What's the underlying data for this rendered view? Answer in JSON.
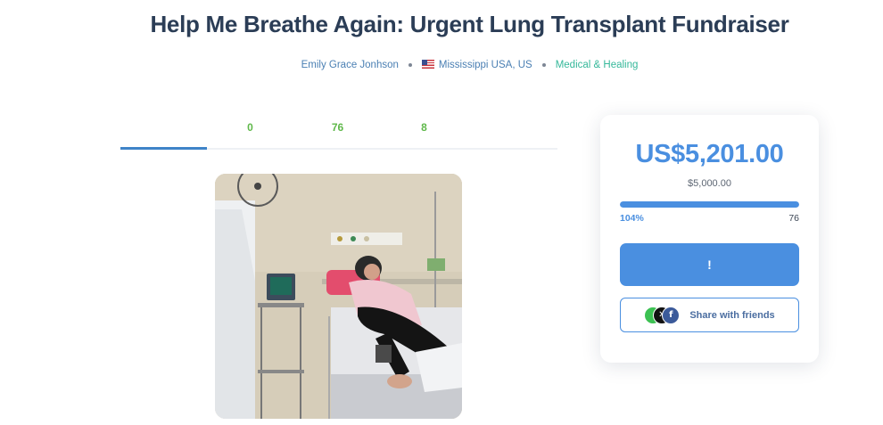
{
  "campaign": {
    "title": "Help Me Breathe Again: Urgent Lung Transplant Fundraiser",
    "organizer": "Emily Grace Jonhson",
    "location": "Mississippi USA, US",
    "category": "Medical & Healing"
  },
  "tabs": [
    {
      "label": ""
    },
    {
      "label": "0"
    },
    {
      "label": "76"
    },
    {
      "label": "8"
    }
  ],
  "icons": {
    "flag": "us-flag-icon",
    "whatsapp": "whatsapp-icon",
    "x": "x-icon",
    "facebook": "facebook-icon"
  },
  "donation": {
    "raised": "US$5,201.00",
    "goal": "$5,000.00",
    "progress_percent": 104,
    "progress_label": "104%",
    "donor_count": "76",
    "donate_label": "!",
    "share_label": "Share with friends"
  },
  "colors": {
    "accent": "#4a8fe0",
    "title": "#2b3d56",
    "tab_count": "#5fb84a",
    "category": "#35b89a"
  }
}
